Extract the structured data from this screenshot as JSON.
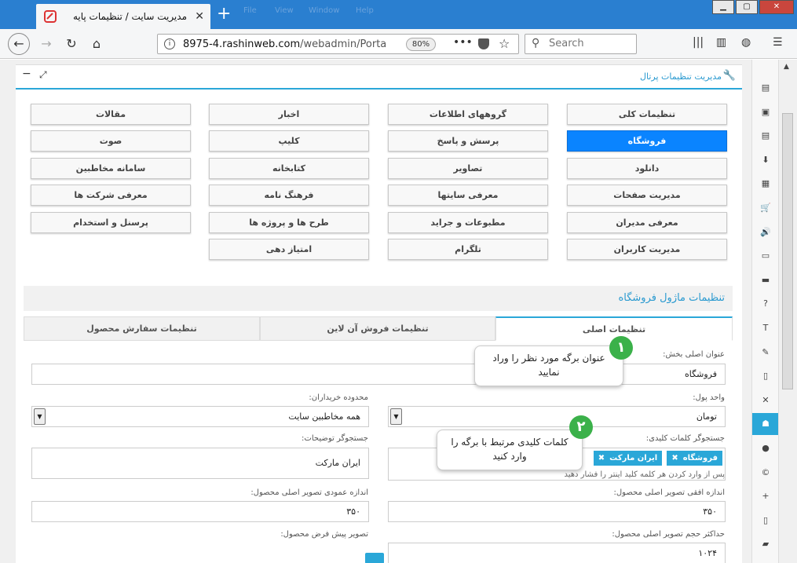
{
  "browser": {
    "tab_title": "مدیریت سایت / تنظیمات پایه",
    "url_host": "8975-4.rashinweb.com",
    "url_path": "/webadmin/Porta",
    "zoom": "80%",
    "search_placeholder": "Search",
    "ghost_menu": [
      "File",
      "View",
      "Window",
      "Help"
    ]
  },
  "panel": {
    "title": "مدیریت تنظیمات پرتال"
  },
  "modules": [
    {
      "label": "تنظیمات کلی",
      "active": false
    },
    {
      "label": "گروههای اطلاعات",
      "active": false
    },
    {
      "label": "اخبار",
      "active": false
    },
    {
      "label": "مقالات",
      "active": false
    },
    {
      "label": "فروشگاه",
      "active": true
    },
    {
      "label": "پرسش و پاسخ",
      "active": false
    },
    {
      "label": "کلیپ",
      "active": false
    },
    {
      "label": "صوت",
      "active": false
    },
    {
      "label": "دانلود",
      "active": false
    },
    {
      "label": "تصاویر",
      "active": false
    },
    {
      "label": "کتابخانه",
      "active": false
    },
    {
      "label": "سامانه مخاطبین",
      "active": false
    },
    {
      "label": "مدیریت صفحات",
      "active": false
    },
    {
      "label": "معرفی سایتها",
      "active": false
    },
    {
      "label": "فرهنگ نامه",
      "active": false
    },
    {
      "label": "معرفی شرکت ها",
      "active": false
    },
    {
      "label": "معرفی مدیران",
      "active": false
    },
    {
      "label": "مطبوعات و جراید",
      "active": false
    },
    {
      "label": "طرح ها و پروژه ها",
      "active": false
    },
    {
      "label": "پرسنل و استخدام",
      "active": false
    },
    {
      "label": "مدیریت کاربران",
      "active": false
    },
    {
      "label": "تلگرام",
      "active": false
    },
    {
      "label": "امتیاز دهی",
      "active": false
    }
  ],
  "section_title": "تنظیمات ماژول فروشگاه",
  "tabs": [
    "تنظیمات اصلی",
    "تنظیمات فروش آن لاین",
    "تنظیمات سفارش محصول"
  ],
  "form": {
    "main_title_label": "عنوان اصلی بخش:",
    "main_title_value": "فروشگاه",
    "currency_label": "واحد پول:",
    "currency_value": "تومان",
    "buyers_label": "محدوده خریداران:",
    "buyers_value": "همه مخاطبین سایت",
    "keywords_label": "جستجوگر کلمات کلیدی:",
    "keywords": [
      "فروشگاه",
      "ایران مارکت"
    ],
    "keywords_hint": "پس از وارد کردن هر کلمه کلید اینتر را فشار دهید",
    "desc_label": "جستجوگر توضیحات:",
    "desc_value": "ایران مارکت",
    "hsize_label": "اندازه افقی تصویر اصلی محصول:",
    "hsize_value": "۳۵۰",
    "vsize_label": "اندازه عمودی تصویر اصلی محصول:",
    "vsize_value": "۳۵۰",
    "maxsize_label": "حداکثر حجم تصویر اصلی محصول:",
    "maxsize_value": "۱۰۲۴",
    "default_img_label": "تصویر پیش فرض محصول:"
  },
  "callouts": [
    {
      "num": "١",
      "text": "عنوان برگه مورد نظر را وراد نمایید"
    },
    {
      "num": "٢",
      "text": "کلمات کلیدی مرتبط با برگه را وارد کنید"
    }
  ],
  "sidebar_icons": [
    "report-icon",
    "image-icon",
    "document-icon",
    "download-icon",
    "film-icon",
    "cart-icon",
    "volume-icon",
    "monitor-icon",
    "book-icon",
    "question-icon",
    "text-icon",
    "pin-icon",
    "file-icon",
    "file-x-icon",
    "tag-icon",
    "user-icon",
    "copyright-icon",
    "user-plus-icon",
    "mobile-icon",
    "chat-icon",
    "mail-icon"
  ],
  "sidebar_glyphs": [
    "▤",
    "▣",
    "▤",
    "⬇",
    "▦",
    "🛒",
    "🔊",
    "▭",
    "▬",
    "?",
    "T",
    "✎",
    "▯",
    "✕",
    "☗",
    "●",
    "©",
    "+",
    "▯",
    "▰",
    "✉"
  ],
  "colors": {
    "accent": "#2aa7d8",
    "active_button": "#0a84ff",
    "badge": "#3bb14a"
  }
}
